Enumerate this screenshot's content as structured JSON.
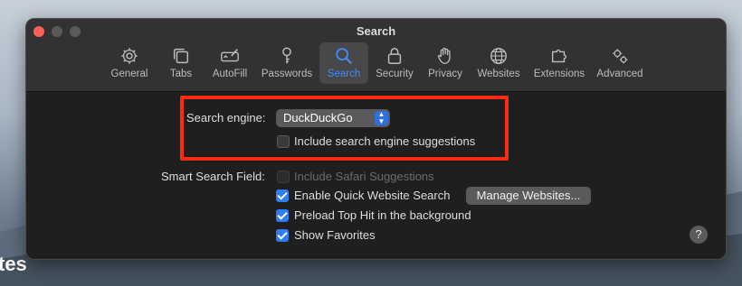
{
  "background": {
    "partial_text": "tes"
  },
  "window": {
    "title": "Search"
  },
  "tabs": [
    {
      "label": "General",
      "icon": "gear-icon"
    },
    {
      "label": "Tabs",
      "icon": "tabs-icon"
    },
    {
      "label": "AutoFill",
      "icon": "autofill-icon"
    },
    {
      "label": "Passwords",
      "icon": "key-icon"
    },
    {
      "label": "Search",
      "icon": "search-icon",
      "active": true
    },
    {
      "label": "Security",
      "icon": "lock-icon"
    },
    {
      "label": "Privacy",
      "icon": "hand-icon"
    },
    {
      "label": "Websites",
      "icon": "globe-icon"
    },
    {
      "label": "Extensions",
      "icon": "puzzle-icon"
    },
    {
      "label": "Advanced",
      "icon": "gears-icon"
    }
  ],
  "search": {
    "engine_label": "Search engine:",
    "engine_value": "DuckDuckGo",
    "suggestions_label": "Include search engine suggestions",
    "suggestions_checked": false
  },
  "smart_search": {
    "label": "Smart Search Field:",
    "options": [
      {
        "label": "Include Safari Suggestions",
        "checked": false,
        "disabled": true
      },
      {
        "label": "Enable Quick Website Search",
        "checked": true
      },
      {
        "label": "Preload Top Hit in the background",
        "checked": true
      },
      {
        "label": "Show Favorites",
        "checked": true
      }
    ],
    "manage_button": "Manage Websites..."
  },
  "help": "?",
  "colors": {
    "accent": "#2f7df6",
    "highlight": "#ff2a12"
  }
}
